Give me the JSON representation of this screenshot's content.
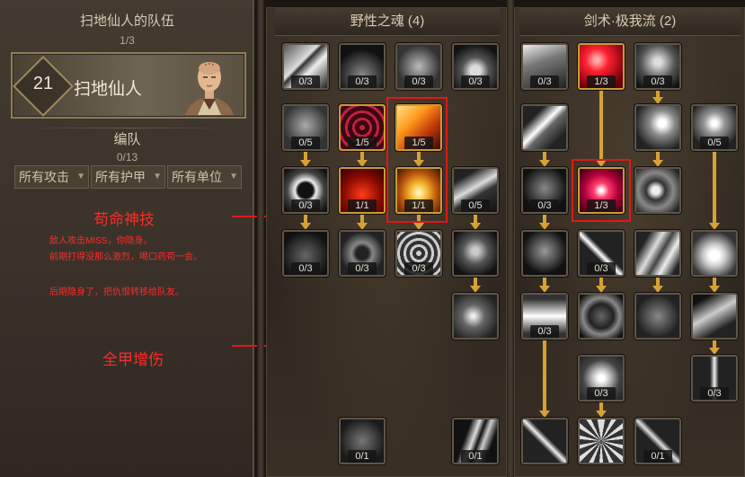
{
  "team": {
    "title": "扫地仙人的队伍",
    "count": "1/3",
    "hero_level": "21",
    "hero_name": "扫地仙人"
  },
  "formation": {
    "title": "编队",
    "count": "0/13",
    "filters": [
      "所有攻击",
      "所有护甲",
      "所有单位"
    ]
  },
  "annotations": {
    "skill1_title": "苟命神技",
    "skill1_desc": [
      "敌人攻击MISS，你隐身。",
      "前期打得没那么激烈，喝口药苟一会。",
      "后期隐身了，把仇恨转移给队友。"
    ],
    "skill2_title": "全甲增伤"
  },
  "trees": [
    {
      "name": "野性之魂 (4)",
      "skills": [
        {
          "id": "w1",
          "count": "0/3",
          "lit": false,
          "art": "claw-slash"
        },
        {
          "id": "w2",
          "count": "0/3",
          "lit": false,
          "art": "quills"
        },
        {
          "id": "w3",
          "count": "0/3",
          "lit": false,
          "art": "rock-fist"
        },
        {
          "id": "w4",
          "count": "0/3",
          "lit": false,
          "art": "paw"
        },
        {
          "id": "w5",
          "count": "0/5",
          "lit": false,
          "art": "wolf"
        },
        {
          "id": "w6",
          "count": "1/5",
          "lit": true,
          "art": "web"
        },
        {
          "id": "w7",
          "count": "1/5",
          "lit": true,
          "art": "flame-wing"
        },
        {
          "id": "w8",
          "count": "0/3",
          "lit": false,
          "art": "fangs"
        },
        {
          "id": "w9",
          "count": "1/1",
          "lit": true,
          "art": "red-maw"
        },
        {
          "id": "w10",
          "count": "1/1",
          "lit": true,
          "art": "gold-swirl"
        },
        {
          "id": "w11",
          "count": "0/5",
          "lit": false,
          "art": "whirl"
        },
        {
          "id": "w12",
          "count": "0/3",
          "lit": false,
          "art": "heart"
        },
        {
          "id": "w13",
          "count": "0/3",
          "lit": false,
          "art": "spike-ball"
        },
        {
          "id": "w14",
          "count": "0/3",
          "lit": false,
          "art": "spiral"
        },
        {
          "id": "w15",
          "count": "",
          "lit": false,
          "art": "skull"
        },
        {
          "id": "w16",
          "count": "",
          "lit": false,
          "art": "vortex"
        },
        {
          "id": "w17",
          "count": "0/1",
          "lit": false,
          "art": "ogre"
        },
        {
          "id": "w18",
          "count": "0/1",
          "lit": false,
          "art": "twin-blade"
        }
      ]
    },
    {
      "name": "剑术·极我流 (2)",
      "skills": [
        {
          "id": "s1",
          "count": "0/3",
          "lit": false,
          "art": "helm"
        },
        {
          "id": "s2",
          "count": "1/3",
          "lit": true,
          "art": "red-flash"
        },
        {
          "id": "s3",
          "count": "0/3",
          "lit": false,
          "art": "gauntlet"
        },
        {
          "id": "s4",
          "count": "",
          "lit": false,
          "art": "slash"
        },
        {
          "id": "s5",
          "count": "",
          "lit": false,
          "art": "crescent"
        },
        {
          "id": "s6",
          "count": "0/5",
          "lit": false,
          "art": "sphere"
        },
        {
          "id": "s7",
          "count": "0/3",
          "lit": false,
          "art": "demon"
        },
        {
          "id": "s8",
          "count": "1/3",
          "lit": true,
          "art": "burst"
        },
        {
          "id": "s9",
          "count": "",
          "lit": false,
          "art": "eye-ball"
        },
        {
          "id": "s10",
          "count": "",
          "lit": false,
          "art": "horns"
        },
        {
          "id": "s11",
          "count": "0/3",
          "lit": false,
          "art": "cross-slash"
        },
        {
          "id": "s12",
          "count": "",
          "lit": false,
          "art": "blades"
        },
        {
          "id": "s13",
          "count": "",
          "lit": false,
          "art": "glow-heart"
        },
        {
          "id": "s14",
          "count": "0/3",
          "lit": false,
          "art": "chevron"
        },
        {
          "id": "s15",
          "count": "",
          "lit": false,
          "art": "twist"
        },
        {
          "id": "s16",
          "count": "",
          "lit": false,
          "art": "fist"
        },
        {
          "id": "s17",
          "count": "",
          "lit": false,
          "art": "wind"
        },
        {
          "id": "s18",
          "count": "0/3",
          "lit": false,
          "art": "star-burst"
        },
        {
          "id": "s19",
          "count": "0/3",
          "lit": false,
          "art": "sword-up"
        },
        {
          "id": "s20",
          "count": "",
          "lit": false,
          "art": "blade-x"
        },
        {
          "id": "s21",
          "count": "",
          "lit": false,
          "art": "sword-rays"
        },
        {
          "id": "s22",
          "count": "0/1",
          "lit": false,
          "art": "crossed-swords"
        }
      ]
    }
  ]
}
